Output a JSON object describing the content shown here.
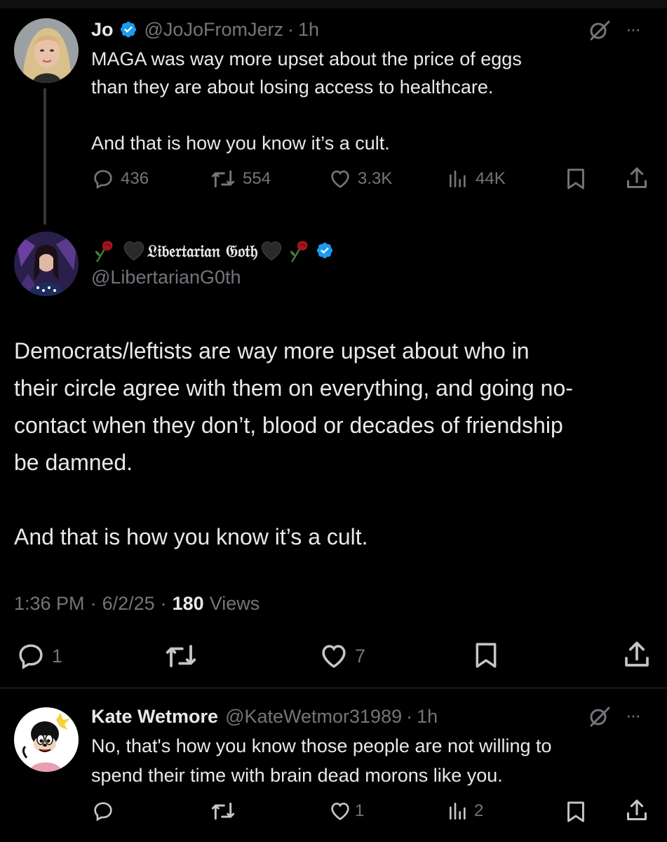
{
  "tweet1": {
    "name": "Jo",
    "handle": "@JoJoFromJerz",
    "dot": "·",
    "time": "1h",
    "text_line1": "MAGA was way more upset about the price of eggs",
    "text_line2": "than they are about losing access to healthcare.",
    "text_line3": "And that is how you know it’s a cult.",
    "replies": "436",
    "reposts": "554",
    "likes": "3.3K",
    "views": "44K",
    "more": "···"
  },
  "tweet2": {
    "name": "𝔏𝔦𝔟𝔢𝔯𝔱𝔞𝔯𝔦𝔞𝔫 𝔊𝔬𝔱𝔥",
    "handle": "@LibertarianG0th",
    "body": [
      "Democrats/leftists are way more upset about who in",
      "their circle agree with them on everything, and going no-",
      "contact when they don’t, blood or decades of friendship",
      "be damned.",
      "And that is how you know it’s a cult."
    ],
    "time": "1:36 PM",
    "sep1": "·",
    "date": "6/2/25",
    "sep2": "·",
    "views_count": "180",
    "views_label": "Views",
    "replies": "1",
    "likes": "7"
  },
  "tweet3": {
    "name": "Kate Wetmore",
    "handle": "@KateWetmor31989",
    "dot": "·",
    "time": "1h",
    "text_line1": "No, that's how you know those people are not willing to",
    "text_line2": "spend their time with brain dead morons like you.",
    "likes": "1",
    "views": "2",
    "more": "···"
  },
  "icons": {
    "verified_color": "#1d9bf0",
    "background": "#000000",
    "text_color": "#e7e9ea",
    "muted_color": "#71767b"
  }
}
